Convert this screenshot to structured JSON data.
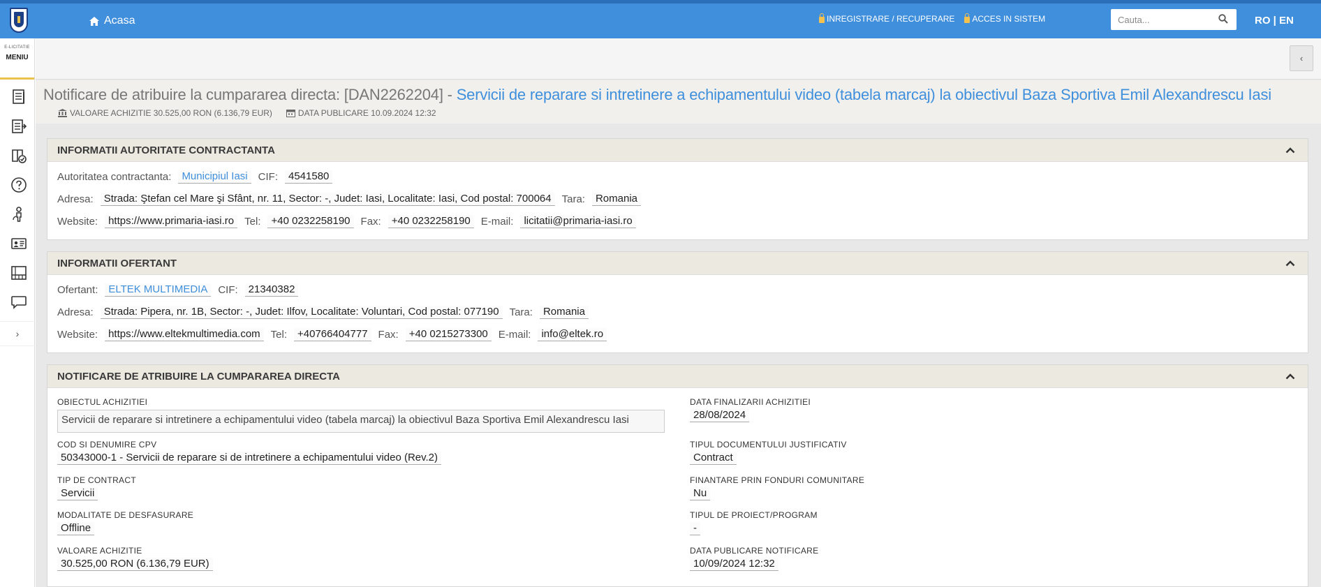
{
  "header": {
    "home_label": "Acasa",
    "register_label": "INREGISTRARE / RECUPERARE",
    "access_label": "ACCES IN SISTEM",
    "search_placeholder": "Cauta...",
    "lang_label": "RO | EN"
  },
  "sidebar": {
    "brand_small": "E-LICITATIE",
    "menu_label": "MENIU",
    "icons": [
      "document-list-icon",
      "export-list-icon",
      "book-check-icon",
      "help-icon",
      "person-icon",
      "id-card-icon",
      "building-icon",
      "chat-icon"
    ],
    "expand_label": "›"
  },
  "page": {
    "collapse_label": "‹",
    "title_prefix": "Notificare de atribuire la cumpararea directa: [DAN2262204] -",
    "title_link": "Servicii de reparare si intretinere a echipamentului video (tabela marcaj) la obiectivul Baza Sportiva Emil Alexandrescu Iasi",
    "value_meta": "VALOARE ACHIZITIE 30.525,00 RON (6.136,79 EUR)",
    "date_meta": "DATA PUBLICARE 10.09.2024 12:32"
  },
  "authority": {
    "heading": "INFORMATII AUTORITATE CONTRACTANTA",
    "authority_label": "Autoritatea contractanta:",
    "authority_value": "Municipiul Iasi",
    "cif_label": "CIF:",
    "cif_value": "4541580",
    "address_label": "Adresa:",
    "address_value": "Strada: Ştefan cel Mare şi Sfânt, nr. 11, Sector: -, Judet: Iasi, Localitate: Iasi, Cod postal: 700064",
    "country_label": "Tara:",
    "country_value": "Romania",
    "website_label": "Website:",
    "website_value": "https://www.primaria-iasi.ro",
    "tel_label": "Tel:",
    "tel_value": "+40 0232258190",
    "fax_label": "Fax:",
    "fax_value": "+40 0232258190",
    "email_label": "E-mail:",
    "email_value": "licitatii@primaria-iasi.ro"
  },
  "bidder": {
    "heading": "INFORMATII OFERTANT",
    "bidder_label": "Ofertant:",
    "bidder_value": "ELTEK MULTIMEDIA",
    "cif_label": "CIF:",
    "cif_value": "21340382",
    "address_label": "Adresa:",
    "address_value": "Strada: Pipera, nr. 1B, Sector: -, Judet: Ilfov, Localitate: Voluntari, Cod postal: 077190",
    "country_label": "Tara:",
    "country_value": "Romania",
    "website_label": "Website:",
    "website_value": "https://www.eltekmultimedia.com",
    "tel_label": "Tel:",
    "tel_value": "+40766404777",
    "fax_label": "Fax:",
    "fax_value": "+40 0215273300",
    "email_label": "E-mail:",
    "email_value": "info@eltek.ro"
  },
  "notice": {
    "heading": "NOTIFICARE DE ATRIBUIRE LA CUMPARAREA DIRECTA",
    "object_label": "OBIECTUL ACHIZITIEI",
    "object_value": "Servicii de reparare si intretinere a echipamentului video (tabela marcaj) la obiectivul Baza Sportiva Emil Alexandrescu Iasi",
    "cpv_label": "COD SI DENUMIRE CPV",
    "cpv_value": "50343000-1 - Servicii de reparare si de intretinere a echipamentului video (Rev.2)",
    "contract_type_label": "TIP DE CONTRACT",
    "contract_type_value": "Servicii",
    "mode_label": "MODALITATE DE DESFASURARE",
    "mode_value": "Offline",
    "value_label": "VALOARE ACHIZITIE",
    "value_value": "30.525,00 RON (6.136,79 EUR)",
    "finish_date_label": "DATA FINALIZARII ACHIZITIEI",
    "finish_date_value": "28/08/2024",
    "doc_type_label": "TIPUL DOCUMENTULUI JUSTIFICATIV",
    "doc_type_value": "Contract",
    "eu_funds_label": "FINANTARE PRIN FONDURI COMUNITARE",
    "eu_funds_value": "Nu",
    "project_label": "TIPUL DE PROIECT/PROGRAM",
    "project_value": "-",
    "pub_date_label": "DATA PUBLICARE NOTIFICARE",
    "pub_date_value": "10/09/2024 12:32"
  },
  "colors": {
    "topbar": "#3f8fdc",
    "accent_yellow": "#e8c24a",
    "link": "#3f8fdc",
    "panel_header": "#ebe9e0"
  }
}
